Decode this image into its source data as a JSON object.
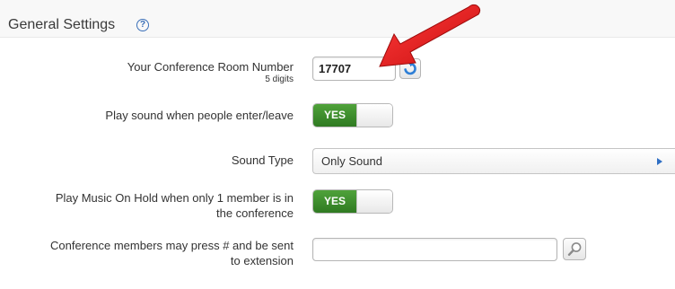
{
  "section": {
    "title": "General Settings",
    "help_glyph": "?"
  },
  "settings": {
    "room_number": {
      "label": "Your Conference Room Number",
      "hint": "5 digits",
      "value": "17707"
    },
    "play_sound": {
      "label": "Play sound when people enter/leave",
      "toggle_label": "YES"
    },
    "sound_type": {
      "label": "Sound Type",
      "selected": "Only Sound"
    },
    "music_on_hold": {
      "label_line1": "Play Music On Hold when only 1 member is in",
      "label_line2": "the conference",
      "toggle_label": "YES"
    },
    "press_hash": {
      "label_line1": "Conference members may press # and be sent",
      "label_line2": "to extension",
      "value": ""
    }
  },
  "icons": {
    "help": "question-circle-icon",
    "refresh": "refresh-icon",
    "search": "magnifier-icon",
    "dropdown": "triangle-right-icon",
    "annotation": "red-arrow"
  },
  "colors": {
    "toggle_on": "#3d8f2e",
    "accent_blue": "#2f6fc4",
    "annotation_red": "#e01b1b"
  }
}
